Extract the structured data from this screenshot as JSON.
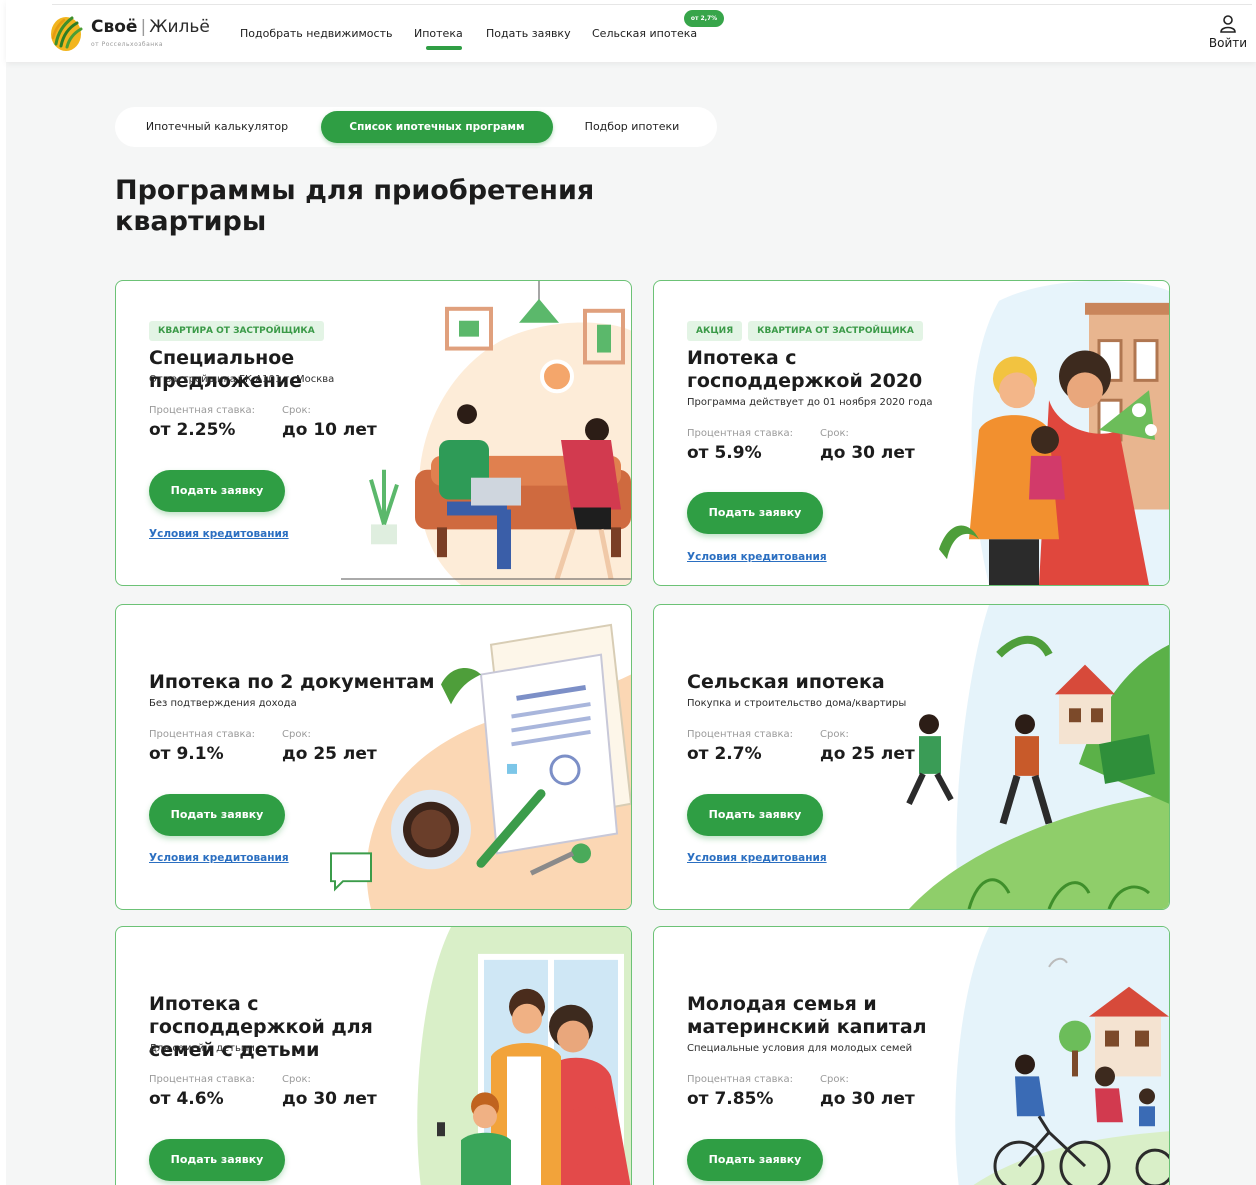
{
  "header": {
    "logo": {
      "brand": "Своё",
      "separator": "|",
      "name": "Жильё",
      "subtitle": "от Россельхозбанка"
    },
    "nav": [
      {
        "label": "Подобрать недвижимость"
      },
      {
        "label": "Ипотека"
      },
      {
        "label": "Подать заявку"
      },
      {
        "label": "Сельская ипотека"
      }
    ],
    "active_nav": "Ипотека",
    "rural_badge": "от 2,7%",
    "login_label": "Войти"
  },
  "tabs": [
    {
      "label": "Ипотечный калькулятор"
    },
    {
      "label": "Список ипотечных программ"
    },
    {
      "label": "Подбор ипотеки"
    }
  ],
  "active_tab": "Список ипотечных программ",
  "page_title": "Программы для приобретения квартиры",
  "rate_label": "Процентная ставка:",
  "term_label": "Срок:",
  "apply_label": "Подать заявку",
  "terms_link": "Условия кредитования",
  "programs": [
    {
      "tags": [
        "КВАРТИРА ОТ ЗАСТРОЙЩИКА"
      ],
      "title": "Специальное предложение",
      "subtitle": "От застройщика ГК А101 г. Москва",
      "rate": "от 2.25%",
      "term": "до 10 лет"
    },
    {
      "tags": [
        "АКЦИЯ",
        "КВАРТИРА ОТ ЗАСТРОЙЩИКА"
      ],
      "title": "Ипотека с господдержкой 2020",
      "subtitle": "Программа действует до 01 ноября 2020 года",
      "rate": "от 5.9%",
      "term": "до 30 лет"
    },
    {
      "tags": [],
      "title": "Ипотека по 2 документам",
      "subtitle": "Без подтверждения дохода",
      "rate": "от 9.1%",
      "term": "до 25 лет"
    },
    {
      "tags": [],
      "title": "Сельская ипотека",
      "subtitle": "Покупка и строительство дома/квартиры",
      "rate": "от 2.7%",
      "term": "до 25 лет"
    },
    {
      "tags": [],
      "title": "Ипотека с господдержкой для семей с детьми",
      "subtitle": "Для семей с детьми",
      "rate": "от 4.6%",
      "term": "до 30 лет"
    },
    {
      "tags": [],
      "title": "Молодая семья и материнский капитал",
      "subtitle": "Специальные условия для молодых семей",
      "rate": "от 7.85%",
      "term": "до 30 лет"
    }
  ],
  "colors": {
    "accent": "#2f9e44",
    "card_border": "#6cc276",
    "tag_bg": "#e3f4e5",
    "link": "#2b6fc1",
    "page_bg": "#f5f6f6"
  }
}
